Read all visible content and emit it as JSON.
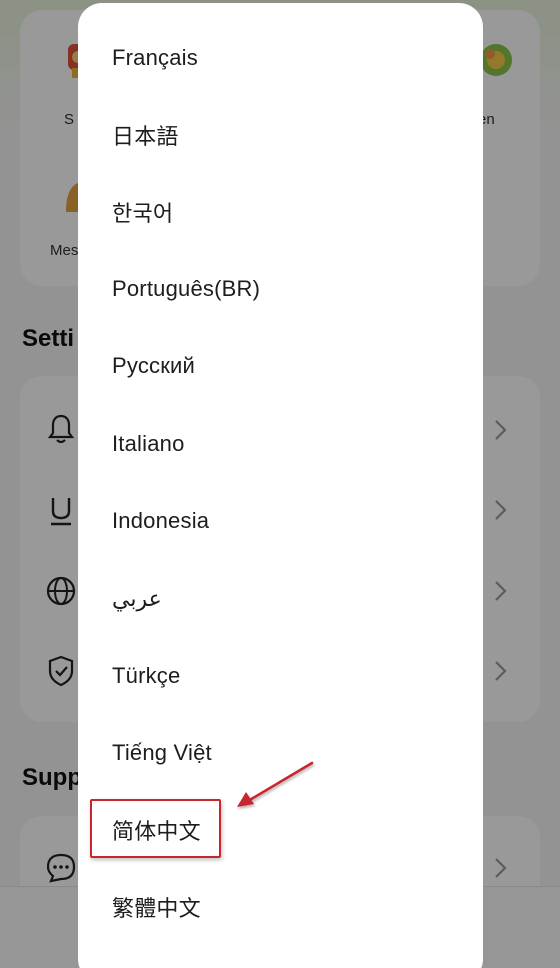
{
  "background": {
    "features": [
      {
        "label": "S",
        "icon": "trophy-icon"
      },
      {
        "label": "en",
        "icon": "flower-icon"
      },
      {
        "label": "Mes",
        "icon": "bell-illustration-icon"
      }
    ],
    "settings_title": "Setti",
    "settings_items": [
      {
        "icon": "bell-icon"
      },
      {
        "icon": "underline-icon"
      },
      {
        "icon": "globe-icon"
      },
      {
        "icon": "shield-check-icon"
      }
    ],
    "support_title": "Supp",
    "support_items": [
      {
        "icon": "chat-bubble-icon"
      }
    ]
  },
  "language_menu": {
    "items": [
      "Français",
      "日本語",
      "한국어",
      "Português(BR)",
      "Русский",
      "Italiano",
      "Indonesia",
      "عربي",
      "Türkçe",
      "Tiếng Việt",
      "简体中文",
      "繁體中文"
    ],
    "highlighted_index": 10
  },
  "annotation": {
    "box_color": "#c8262d",
    "arrow_color": "#c8262d"
  }
}
